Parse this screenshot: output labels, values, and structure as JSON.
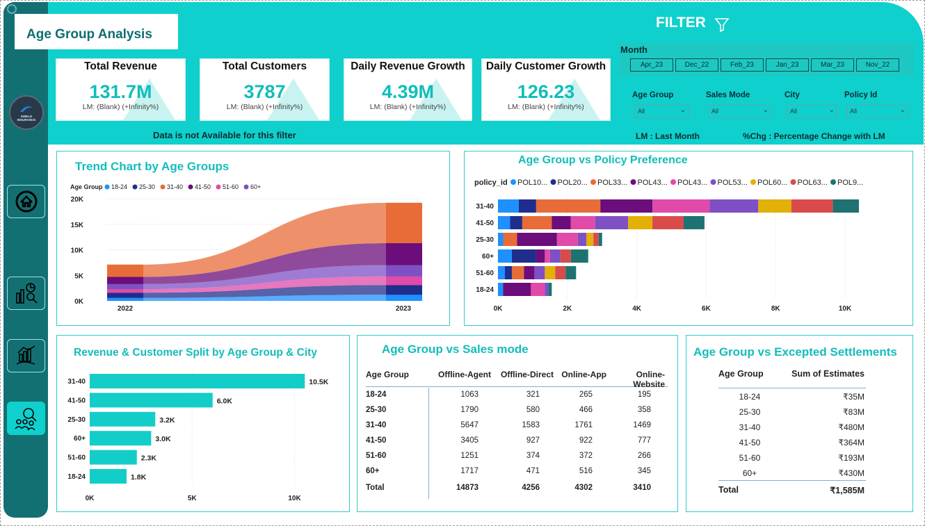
{
  "page_title": "Age Group Analysis",
  "filter": {
    "title": "FILTER",
    "month_label": "Month",
    "months": [
      "Apr_23",
      "Dec_22",
      "Feb_23",
      "Jan_23",
      "Mar_23",
      "Nov_22"
    ],
    "slicers": [
      {
        "label": "Age Group",
        "value": "All"
      },
      {
        "label": "Sales Mode",
        "value": "All"
      },
      {
        "label": "City",
        "value": "All"
      },
      {
        "label": "Policy Id",
        "value": "All"
      }
    ],
    "legend_lm": "LM : Last Month",
    "legend_chg": "%Chg : Percentage Change with LM"
  },
  "logo_text": "SHIELD INSURANCE",
  "kpis": [
    {
      "label": "Total Revenue",
      "value": "131.7M",
      "sub": "LM: (Blank) (+Infinity%)"
    },
    {
      "label": "Total Customers",
      "value": "3787",
      "sub": "LM: (Blank) (+Infinity%)"
    },
    {
      "label": "Daily Revenue Growth",
      "value": "4.39M",
      "sub": "LM: (Blank) (+Infinity%)"
    },
    {
      "label": "Daily Customer Growth",
      "value": "126.23",
      "sub": "LM: (Blank) (+Infinity%)"
    }
  ],
  "no_data_msg": "Data is not Available for this filter",
  "trend": {
    "title": "Trend Chart by Age Groups",
    "legend_title": "Age Group"
  },
  "policy": {
    "title": "Age Group vs Policy Preference",
    "legend_title": "policy_id"
  },
  "split": {
    "title": "Revenue & Customer Split by Age Group & City"
  },
  "sales": {
    "title": "Age Group vs Sales mode",
    "headers": [
      "Age Group",
      "Offline-Agent",
      "Offline-Direct",
      "Online-App",
      "Online-Website"
    ],
    "rows": [
      [
        "18-24",
        "1063",
        "321",
        "265",
        "195"
      ],
      [
        "25-30",
        "1790",
        "580",
        "466",
        "358"
      ],
      [
        "31-40",
        "5647",
        "1583",
        "1761",
        "1469"
      ],
      [
        "41-50",
        "3405",
        "927",
        "922",
        "777"
      ],
      [
        "51-60",
        "1251",
        "374",
        "372",
        "266"
      ],
      [
        "60+",
        "1717",
        "471",
        "516",
        "345"
      ]
    ],
    "total": [
      "Total",
      "14873",
      "4256",
      "4302",
      "3410"
    ]
  },
  "settle": {
    "title": "Age Group vs Excepted Settlements",
    "headers": [
      "Age Group",
      "Sum of Estimates"
    ],
    "rows": [
      [
        "18-24",
        "₹35M"
      ],
      [
        "25-30",
        "₹83M"
      ],
      [
        "31-40",
        "₹480M"
      ],
      [
        "41-50",
        "₹364M"
      ],
      [
        "51-60",
        "₹193M"
      ],
      [
        "60+",
        "₹430M"
      ]
    ],
    "total": [
      "Total",
      "₹1,585M"
    ]
  },
  "chart_data": [
    {
      "type": "area",
      "title": "Trend Chart by Age Groups",
      "x": [
        "2022",
        "2023"
      ],
      "ylim": [
        0,
        20000
      ],
      "yticks": [
        "0K",
        "5K",
        "10K",
        "15K",
        "20K"
      ],
      "legend_title": "Age Group",
      "series": [
        {
          "name": "18-24",
          "values": [
            600,
            1200
          ],
          "color": "#1e90ff"
        },
        {
          "name": "25-30",
          "values": [
            1000,
            1900
          ],
          "color": "#1f2e8c"
        },
        {
          "name": "31-40",
          "values": [
            2400,
            7900
          ],
          "color": "#e86c38"
        },
        {
          "name": "41-50",
          "values": [
            1400,
            4300
          ],
          "color": "#6b0d7a"
        },
        {
          "name": "51-60",
          "values": [
            700,
            1700
          ],
          "color": "#e04aa8"
        },
        {
          "name": "60+",
          "values": [
            1000,
            2200
          ],
          "color": "#7e50c4"
        }
      ]
    },
    {
      "type": "bar",
      "title": "Age Group vs Policy Preference",
      "legend_title": "policy_id",
      "categories": [
        "31-40",
        "41-50",
        "25-30",
        "60+",
        "51-60",
        "18-24"
      ],
      "xlim": [
        0,
        10500
      ],
      "xticks": [
        "0K",
        "2K",
        "4K",
        "6K",
        "8K",
        "10K"
      ],
      "series": [
        {
          "name": "POL10...",
          "color": "#1e90ff",
          "values": [
            600,
            350,
            150,
            400,
            200,
            150
          ]
        },
        {
          "name": "POL20...",
          "color": "#1f2e8c",
          "values": [
            500,
            350,
            0,
            700,
            200,
            0
          ]
        },
        {
          "name": "POL33...",
          "color": "#e86c38",
          "values": [
            1850,
            850,
            400,
            0,
            350,
            0
          ]
        },
        {
          "name": "POL43...",
          "color": "#6b0d7a",
          "values": [
            1500,
            550,
            1150,
            250,
            300,
            800
          ]
        },
        {
          "name": "POL43...",
          "color": "#e04aa8",
          "values": [
            1650,
            700,
            600,
            150,
            0,
            400
          ]
        },
        {
          "name": "POL53...",
          "color": "#7e50c4",
          "values": [
            1400,
            950,
            250,
            300,
            300,
            100
          ]
        },
        {
          "name": "POL60...",
          "color": "#e2b007",
          "values": [
            950,
            700,
            200,
            0,
            300,
            0
          ]
        },
        {
          "name": "POL63...",
          "color": "#d94b4b",
          "values": [
            1200,
            900,
            150,
            300,
            300,
            0
          ]
        },
        {
          "name": "POL9...",
          "color": "#1e7272",
          "values": [
            750,
            600,
            100,
            500,
            300,
            100
          ]
        }
      ]
    },
    {
      "type": "bar",
      "title": "Revenue & Customer Split by Age Group & City",
      "categories": [
        "31-40",
        "41-50",
        "25-30",
        "60+",
        "51-60",
        "18-24"
      ],
      "values": [
        10500,
        6000,
        3200,
        3000,
        2300,
        1800
      ],
      "labels": [
        "10.5K",
        "6.0K",
        "3.2K",
        "3.0K",
        "2.3K",
        "1.8K"
      ],
      "xlim": [
        0,
        11000
      ],
      "xticks": [
        "0K",
        "5K",
        "10K"
      ]
    }
  ]
}
